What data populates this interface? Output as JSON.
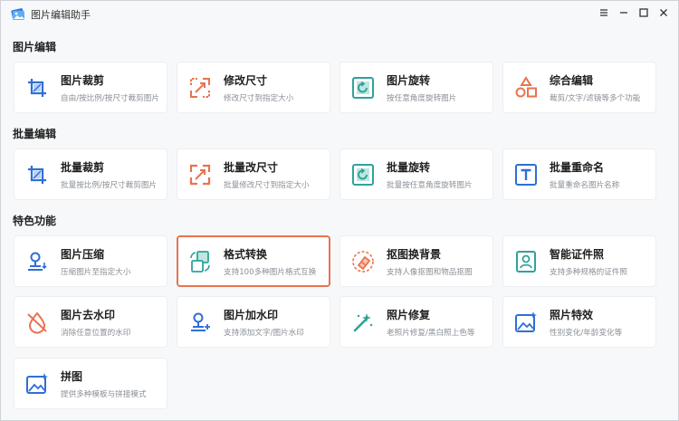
{
  "app": {
    "title": "图片编辑助手"
  },
  "window_controls": [
    "menu",
    "minimize",
    "maximize",
    "close"
  ],
  "sections": [
    {
      "title": "图片编辑",
      "items": [
        {
          "title": "图片裁剪",
          "desc": "自由/按比例/按尺寸裁剪图片",
          "icon": "crop-icon"
        },
        {
          "title": "修改尺寸",
          "desc": "修改尺寸到指定大小",
          "icon": "resize-icon"
        },
        {
          "title": "图片旋转",
          "desc": "按任意角度旋转图片",
          "icon": "rotate-icon"
        },
        {
          "title": "综合编辑",
          "desc": "裁剪/文字/滤镜等多个功能",
          "icon": "shapes-icon"
        }
      ]
    },
    {
      "title": "批量编辑",
      "items": [
        {
          "title": "批量裁剪",
          "desc": "批量按比例/按尺寸裁剪图片",
          "icon": "batch-crop-icon"
        },
        {
          "title": "批量改尺寸",
          "desc": "批量修改尺寸到指定大小",
          "icon": "batch-resize-icon"
        },
        {
          "title": "批量旋转",
          "desc": "批量按任意角度旋转图片",
          "icon": "batch-rotate-icon"
        },
        {
          "title": "批量重命名",
          "desc": "批量重命名图片名称",
          "icon": "rename-icon"
        }
      ]
    },
    {
      "title": "特色功能",
      "items": [
        {
          "title": "图片压缩",
          "desc": "压缩图片至指定大小",
          "icon": "compress-icon"
        },
        {
          "title": "格式转换",
          "desc": "支持100多种图片格式互换",
          "icon": "convert-icon"
        },
        {
          "title": "抠图换背景",
          "desc": "支持人像抠图和物品抠图",
          "icon": "eraser-icon"
        },
        {
          "title": "智能证件照",
          "desc": "支持多种规格的证件照",
          "icon": "id-photo-icon"
        },
        {
          "title": "图片去水印",
          "desc": "消除任意位置的水印",
          "icon": "remove-watermark-icon"
        },
        {
          "title": "图片加水印",
          "desc": "支持添加文字/图片水印",
          "icon": "add-watermark-icon"
        },
        {
          "title": "照片修复",
          "desc": "老照片修复/黑白照上色等",
          "icon": "magic-wand-icon"
        },
        {
          "title": "照片特效",
          "desc": "性别变化/年龄变化等",
          "icon": "photo-effect-icon"
        },
        {
          "title": "拼图",
          "desc": "提供多种模板与拼接模式",
          "icon": "collage-icon"
        }
      ]
    }
  ],
  "selected_item": "格式转换",
  "colors": {
    "accent_blue": "#2f6fd6",
    "accent_orange": "#e8734e",
    "accent_teal": "#2fa39a"
  }
}
